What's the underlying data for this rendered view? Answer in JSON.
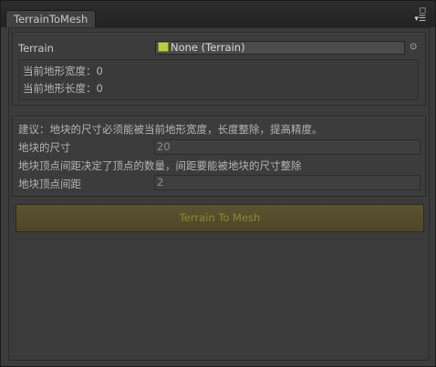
{
  "window": {
    "tab_title": "TerrainToMesh"
  },
  "terrain_section": {
    "terrain_label": "Terrain",
    "terrain_value": "None (Terrain)",
    "width_label": "当前地形宽度：0",
    "length_label": "当前地形长度：0"
  },
  "settings_section": {
    "tip_size": "建议：地块的尺寸必须能被当前地形宽度，长度整除，提高精度。",
    "block_size_label": "地块的尺寸",
    "block_size_value": "20",
    "tip_spacing": "地块顶点间距决定了顶点的数量，间距要能被地块的尺寸整除",
    "vertex_spacing_label": "地块顶点间距",
    "vertex_spacing_value": "2"
  },
  "action": {
    "button_label": "Terrain To Mesh"
  }
}
